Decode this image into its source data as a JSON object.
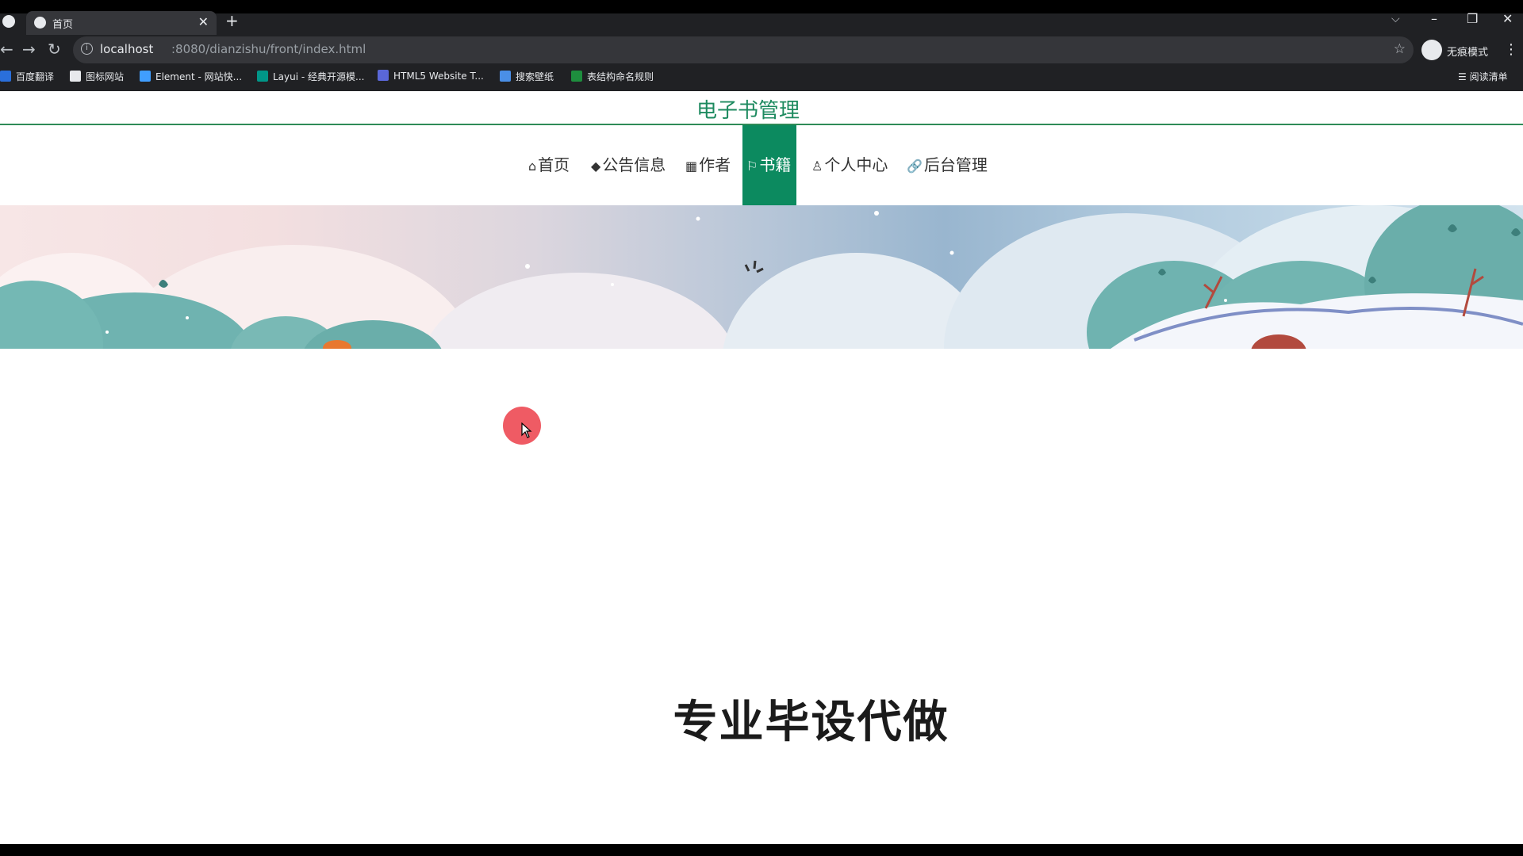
{
  "browser": {
    "tab": {
      "title": "首页",
      "close": "✕"
    },
    "new_tab": "+",
    "tab_dropdown": "⌵",
    "window_controls": {
      "minimize": "–",
      "restore": "❐",
      "close": "✕"
    },
    "nav": {
      "back": "←",
      "forward": "→",
      "reload": "↻"
    },
    "address": {
      "host": "localhost",
      "path": ":8080/dianzishu/front/index.html"
    },
    "bookmark_star": "☆",
    "profile_label": "无痕模式",
    "menu": "⋮",
    "bookmarks": [
      {
        "label": "百度翻译",
        "icon": "baidu-translate-icon",
        "color": "#2a6fdb"
      },
      {
        "label": "图标网站",
        "icon": "flag-icon",
        "color": "#e8eaed"
      },
      {
        "label": "Element - 网站快...",
        "icon": "element-hexagon-icon",
        "color": "#409eff"
      },
      {
        "label": "Layui - 经典开源模...",
        "icon": "layui-icon",
        "color": "#009688"
      },
      {
        "label": "HTML5 Website T...",
        "icon": "html5-template-icon",
        "color": "#5a67d8"
      },
      {
        "label": "搜索壁纸",
        "icon": "wallpaper-icon",
        "color": "#4a8fe7"
      },
      {
        "label": "表结构命名规则",
        "icon": "sheet-icon",
        "color": "#1e8e3e"
      }
    ],
    "reading_list": "阅读清单"
  },
  "site": {
    "title": "电子书管理",
    "nav": [
      {
        "label": "首页",
        "icon": "home-icon",
        "glyph": "⌂"
      },
      {
        "label": "公告信息",
        "icon": "graduation-cap-icon",
        "glyph": "◆"
      },
      {
        "label": "作者",
        "icon": "grid-icon",
        "glyph": "▦"
      },
      {
        "label": "书籍",
        "icon": "flag-icon",
        "glyph": "⚐",
        "active": true
      },
      {
        "label": "个人中心",
        "icon": "user-icon",
        "glyph": "♙"
      },
      {
        "label": "后台管理",
        "icon": "link-icon",
        "glyph": "🔗"
      }
    ],
    "accent_color": "#0c8a5f"
  },
  "overlay": {
    "watermark": "专业毕设代做"
  }
}
